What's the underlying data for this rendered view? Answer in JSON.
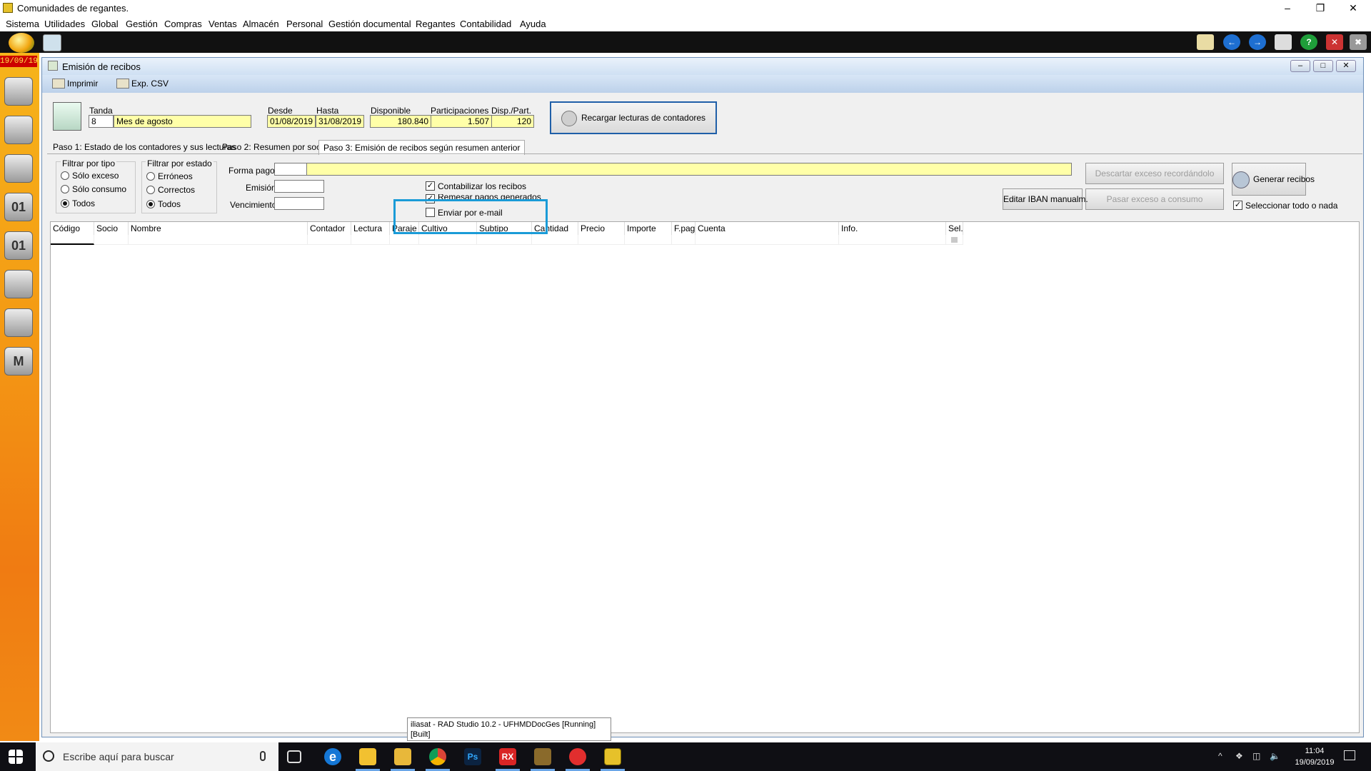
{
  "window": {
    "title": "Comunidades de regantes."
  },
  "menu": [
    "Sistema",
    "Utilidades",
    "Global",
    "Gestión",
    "Compras",
    "Ventas",
    "Almacén",
    "Personal",
    "Gestión documental",
    "Regantes",
    "Contabilidad",
    "Ayuda"
  ],
  "sidebar": {
    "date": "19/09/19"
  },
  "child": {
    "title": "Emisión de recibos",
    "toolbar": {
      "print": "Imprimir",
      "export": "Exp. CSV"
    },
    "header": {
      "tanda_label": "Tanda",
      "tanda_num": "8",
      "tanda_name": "Mes de agosto",
      "desde_label": "Desde",
      "desde": "01/08/2019",
      "hasta_label": "Hasta",
      "hasta": "31/08/2019",
      "disponible_label": "Disponible",
      "disponible": "180.840",
      "participaciones_label": "Participaciones",
      "participaciones": "1.507",
      "disp_part_label": "Disp./Part.",
      "disp_part": "120",
      "reload_button": "Recargar lecturas de contadores"
    },
    "tabs": [
      "Paso 1: Estado de los contadores y sus lecturas",
      "Paso 2: Resumen por socio",
      "Paso 3: Emisión de recibos según resumen anterior"
    ],
    "filters": {
      "tipo_title": "Filtrar por tipo",
      "tipo_options": [
        "Sólo exceso",
        "Sólo consumo",
        "Todos"
      ],
      "tipo_selected": "Todos",
      "estado_title": "Filtrar por estado",
      "estado_options": [
        "Erróneos",
        "Correctos",
        "Todos"
      ],
      "estado_selected": "Todos"
    },
    "form": {
      "forma_pago_label": "Forma pago",
      "emision_label": "Emisión",
      "vencimiento_label": "Vencimiento",
      "contabilizar": "Contabilizar los recibos",
      "remesar": "Remesar pagos generados",
      "email": "Enviar por e-mail"
    },
    "actions": {
      "descartar": "Descartar exceso recordándolo",
      "pasar": "Pasar exceso a consumo",
      "editar_iban": "Editar IBAN manualm.",
      "generar": "Generar recibos",
      "seleccionar": "Seleccionar todo o nada"
    },
    "grid": {
      "columns": [
        "Código",
        "Socio",
        "Nombre",
        "Contador",
        "Lectura",
        "Paraje",
        "Cultivo",
        "Subtipo",
        "Cantidad",
        "Precio",
        "Importe",
        "F.pag.",
        "Cuenta",
        "Info.",
        "Sel."
      ]
    }
  },
  "tooltip": {
    "line1": "iliasat - RAD Studio 10.2 - UFHMDDocGes [Running]",
    "line2": "[Built]"
  },
  "taskbar": {
    "search_placeholder": "Escribe aquí para buscar",
    "time": "11:04",
    "date": "19/09/2019"
  }
}
